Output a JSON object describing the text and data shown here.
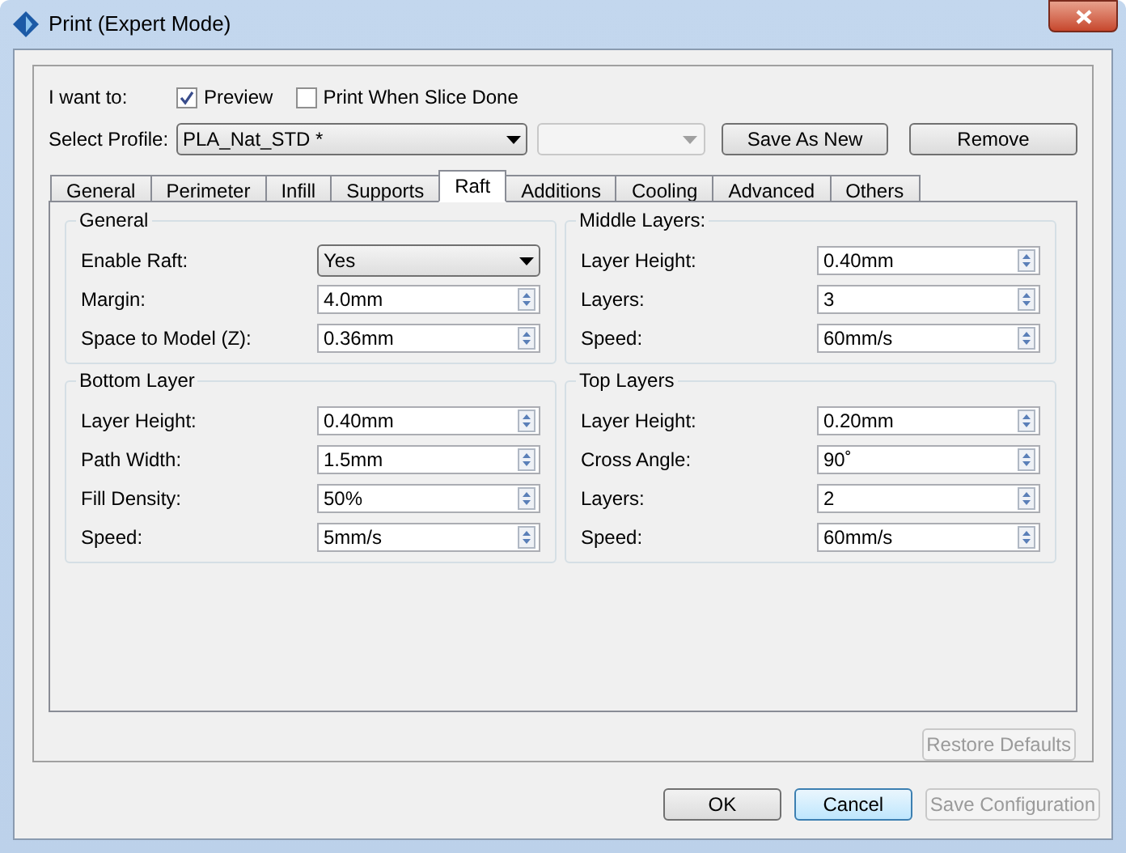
{
  "window": {
    "title": "Print (Expert Mode)"
  },
  "i_want_to": {
    "label": "I want to:",
    "options": [
      {
        "label": "Preview",
        "checked": true
      },
      {
        "label": "Print When Slice Done",
        "checked": false
      }
    ]
  },
  "profile": {
    "label": "Select Profile:",
    "value": "PLA_Nat_STD *",
    "second_select": {
      "disabled": true
    },
    "buttons": [
      {
        "label": "Save As New"
      },
      {
        "label": "Remove"
      }
    ]
  },
  "tabs": [
    {
      "label": "General",
      "selected": false
    },
    {
      "label": "Perimeter",
      "selected": false
    },
    {
      "label": "Infill",
      "selected": false
    },
    {
      "label": "Supports",
      "selected": false
    },
    {
      "label": "Raft",
      "selected": true
    },
    {
      "label": "Additions",
      "selected": false
    },
    {
      "label": "Cooling",
      "selected": false
    },
    {
      "label": "Advanced",
      "selected": false
    },
    {
      "label": "Others",
      "selected": false
    }
  ],
  "columns": [
    [
      {
        "title": "General",
        "fields": [
          {
            "label": "Enable Raft:",
            "value": "Yes",
            "kind": "select"
          },
          {
            "label": "Margin:",
            "value": "4.0mm",
            "kind": "spin"
          },
          {
            "label": "Space to Model (Z):",
            "value": "0.36mm",
            "kind": "spin"
          }
        ]
      },
      {
        "title": "Bottom Layer",
        "fields": [
          {
            "label": "Layer Height:",
            "value": "0.40mm",
            "kind": "spin"
          },
          {
            "label": "Path Width:",
            "value": "1.5mm",
            "kind": "spin"
          },
          {
            "label": "Fill Density:",
            "value": "50%",
            "kind": "spin"
          },
          {
            "label": "Speed:",
            "value": "5mm/s",
            "kind": "spin"
          }
        ]
      }
    ],
    [
      {
        "title": "Middle Layers:",
        "fields": [
          {
            "label": "Layer Height:",
            "value": "0.40mm",
            "kind": "spin"
          },
          {
            "label": "Layers:",
            "value": "3",
            "kind": "spin"
          },
          {
            "label": "Speed:",
            "value": "60mm/s",
            "kind": "spin"
          }
        ]
      },
      {
        "title": "Top Layers",
        "fields": [
          {
            "label": "Layer Height:",
            "value": "0.20mm",
            "kind": "spin"
          },
          {
            "label": "Cross Angle:",
            "value": "90˚",
            "kind": "spin"
          },
          {
            "label": "Layers:",
            "value": "2",
            "kind": "spin"
          },
          {
            "label": "Speed:",
            "value": "60mm/s",
            "kind": "spin"
          }
        ]
      }
    ]
  ],
  "restore_button": {
    "label": "Restore Defaults",
    "disabled": true
  },
  "footer_buttons": [
    {
      "label": "OK",
      "default": false,
      "disabled": false
    },
    {
      "label": "Cancel",
      "default": true,
      "disabled": false
    },
    {
      "label": "Save Configuration",
      "default": false,
      "disabled": true
    }
  ]
}
